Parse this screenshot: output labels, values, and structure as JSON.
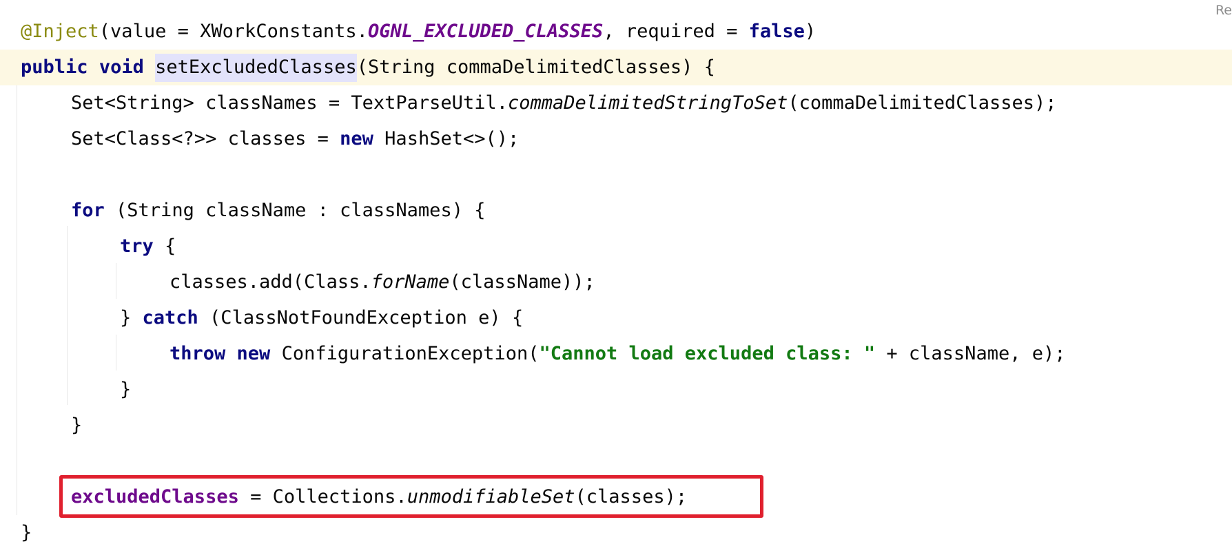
{
  "corner_label": "Re",
  "code": {
    "line1": {
      "annotation": "@Inject",
      "t1": "(value = XWorkConstants.",
      "const_name": "OGNL_EXCLUDED_CLASSES",
      "t2": ", required = ",
      "kw_false": "false",
      "t3": ")"
    },
    "line2": {
      "kw_public": "public",
      "sp1": " ",
      "kw_void": "void",
      "sp2": " ",
      "method_name": "setExcludedClasses",
      "t1": "(String commaDelimitedClasses) {"
    },
    "line3": {
      "t1": "Set<String> classNames = TextParseUtil.",
      "method": "commaDelimitedStringToSet",
      "t2": "(commaDelimitedClasses);"
    },
    "line4": {
      "t1": "Set<Class<?>> classes = ",
      "kw_new": "new",
      "t2": " HashSet<>();"
    },
    "line6": {
      "kw_for": "for",
      "t1": " (String className : classNames) {"
    },
    "line7": {
      "kw_try": "try",
      "t1": " {"
    },
    "line8": {
      "t1": "classes.add(Class.",
      "method": "forName",
      "t2": "(className));"
    },
    "line9": {
      "t1": "} ",
      "kw_catch": "catch",
      "t2": " (ClassNotFoundException e) {"
    },
    "line10": {
      "kw_throw": "throw",
      "sp1": " ",
      "kw_new": "new",
      "t1": " ConfigurationException(",
      "str": "\"Cannot load excluded class: \"",
      "t2": " + className, e);"
    },
    "line11": {
      "t1": "}"
    },
    "line12": {
      "t1": "}"
    },
    "line14": {
      "field": "excludedClasses",
      "t1": " = Collections.",
      "method": "unmodifiableSet",
      "t2": "(classes);"
    },
    "line15": {
      "t1": "}"
    }
  },
  "colors": {
    "keyword": "#0b0b80",
    "field": "#6e0a8c",
    "string": "#127a12",
    "annotation": "#8a8a10",
    "current_line": "#fdf8e3",
    "method_highlight": "#e3e3fb",
    "highlight_box": "#e0202e"
  }
}
